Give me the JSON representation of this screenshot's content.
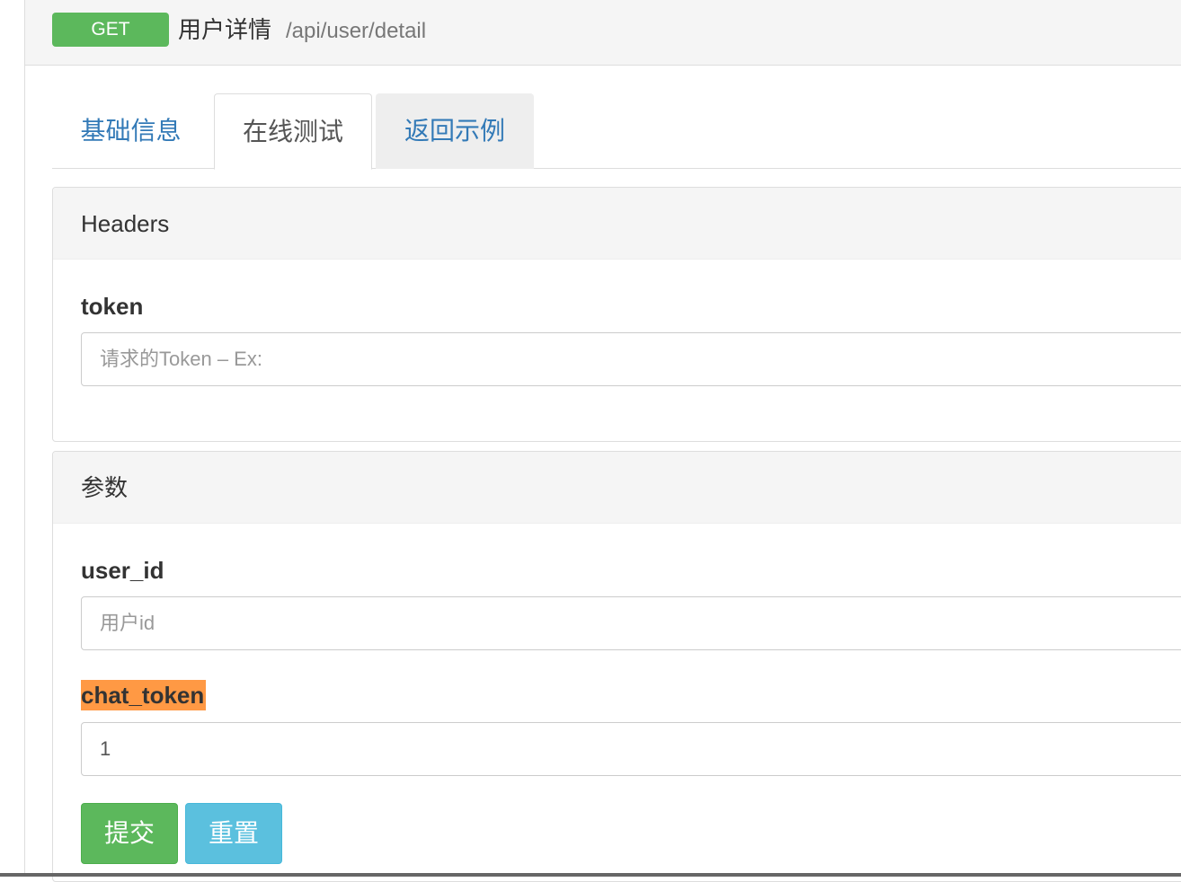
{
  "api": {
    "method": "GET",
    "title": "用户详情",
    "path": "/api/user/detail"
  },
  "tabs": [
    {
      "label": "基础信息"
    },
    {
      "label": "在线测试"
    },
    {
      "label": "返回示例"
    }
  ],
  "headers_panel": {
    "title": "Headers",
    "fields": [
      {
        "label": "token",
        "placeholder": "请求的Token – Ex:",
        "value": ""
      }
    ]
  },
  "params_panel": {
    "title": "参数",
    "fields": [
      {
        "label": "user_id",
        "placeholder": "用户id",
        "value": ""
      },
      {
        "label": "chat_token",
        "placeholder": "",
        "value": "1"
      }
    ]
  },
  "actions": {
    "submit_label": "提交",
    "reset_label": "重置"
  },
  "colors": {
    "method_badge": "#5cb85c",
    "tab_link": "#337ab7",
    "highlight": "#ff9944",
    "submit": "#5cb85c",
    "reset": "#5bc0de"
  }
}
